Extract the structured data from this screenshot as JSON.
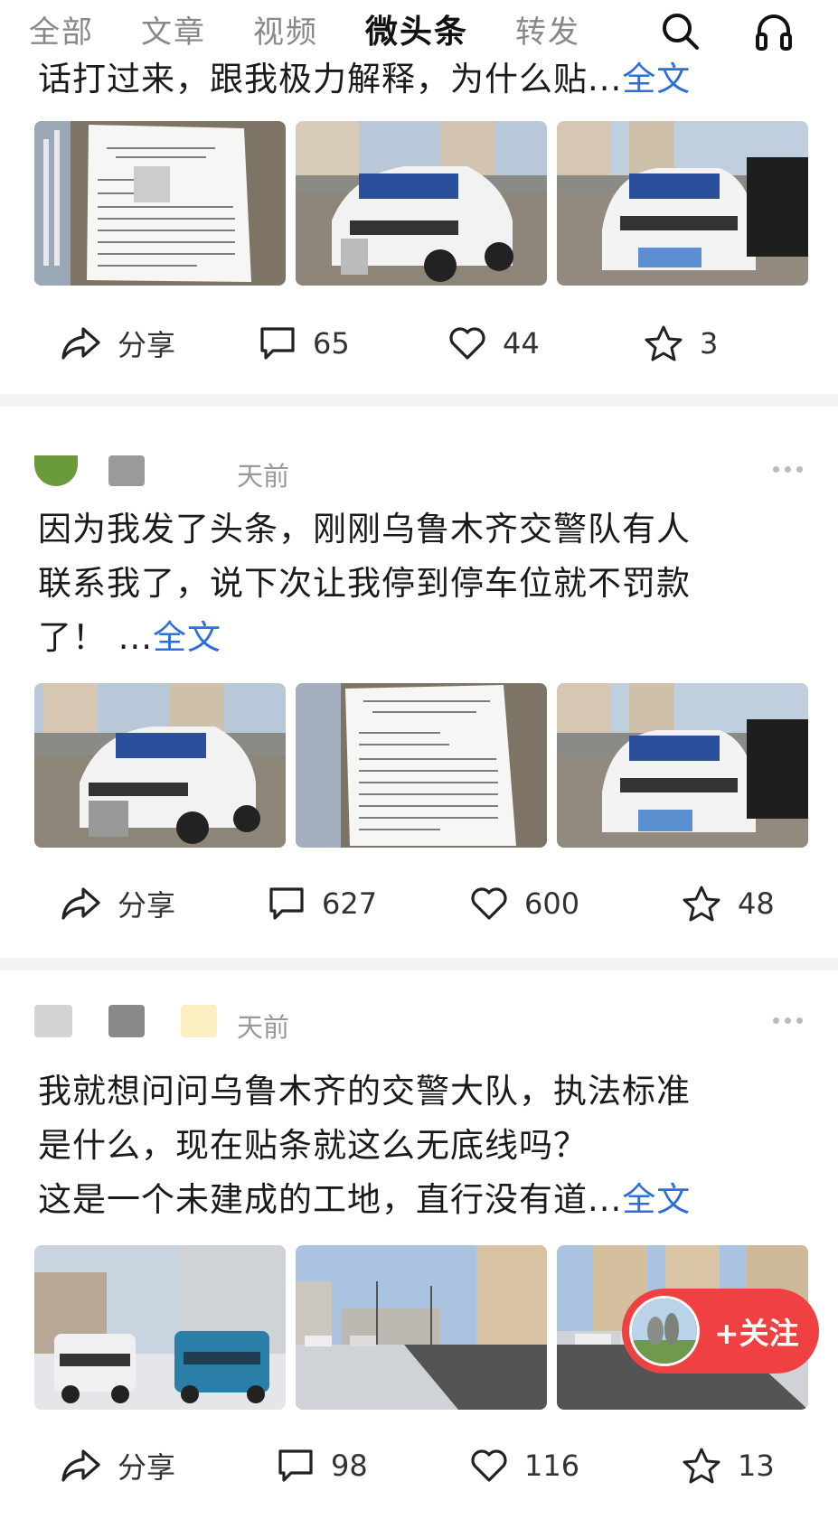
{
  "tabs": [
    {
      "label": "全部",
      "active": false
    },
    {
      "label": "文章",
      "active": false
    },
    {
      "label": "视频",
      "active": false
    },
    {
      "label": "微头条",
      "active": true
    },
    {
      "label": "转发",
      "active": false
    }
  ],
  "top_icons": [
    "search-icon",
    "headphones-icon"
  ],
  "posts": [
    {
      "meta_time": "",
      "text": "话打过来，跟我极力解释，为什么贴...",
      "more_label": "全文",
      "images": [
        "notice-paper",
        "white-suv-side",
        "white-suv-front"
      ],
      "share_label": "分享",
      "comments": "65",
      "likes": "44",
      "favorites": "3"
    },
    {
      "meta_time": "天前",
      "text": "因为我发了头条，刚刚乌鲁木齐交警队有人\n联系我了，说下次让我停到停车位就不罚款\n了！ ...",
      "more_label": "全文",
      "images": [
        "white-suv-side",
        "notice-paper",
        "white-suv-front"
      ],
      "share_label": "分享",
      "comments": "627",
      "likes": "600",
      "favorites": "48"
    },
    {
      "meta_time": "天前",
      "text": "我就想问问乌鲁木齐的交警大队，执法标准\n是什么，现在贴条就这么无底线吗？\n这是一个未建成的工地，直行没有道...",
      "more_label": "全文",
      "images": [
        "parked-cars-snow",
        "street-view",
        "street-view-2"
      ],
      "share_label": "分享",
      "comments": "98",
      "likes": "116",
      "favorites": "13"
    }
  ],
  "follow_button": {
    "label": "+关注"
  },
  "colors": {
    "link": "#2d6fd8",
    "follow": "#f04142",
    "divider": "#f2f2f2"
  }
}
